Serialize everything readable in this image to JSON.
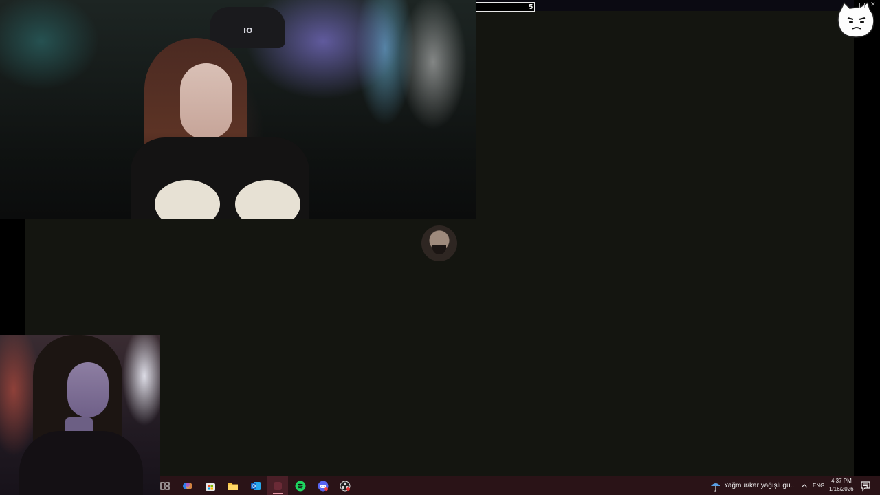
{
  "overlay": {
    "counter_value": "5"
  },
  "taskbar": {
    "apps": [
      {
        "name": "task-view-icon"
      },
      {
        "name": "copilot-icon"
      },
      {
        "name": "microsoft-store-icon"
      },
      {
        "name": "file-explorer-icon"
      },
      {
        "name": "outlook-icon"
      },
      {
        "name": "active-app-icon"
      },
      {
        "name": "spotify-icon"
      },
      {
        "name": "discord-icon"
      },
      {
        "name": "obs-icon"
      }
    ],
    "weather_text": "Yağmur/kar yağışlı gü...",
    "language": "ENG",
    "time": "4:37 PM",
    "date": "1/16/2026",
    "notification_count": "4"
  },
  "colors": {
    "stage_background": "#141510",
    "taskbar_background": "#2a1317",
    "spotify_green": "#1ed760",
    "discord_purple": "#5865f2"
  }
}
